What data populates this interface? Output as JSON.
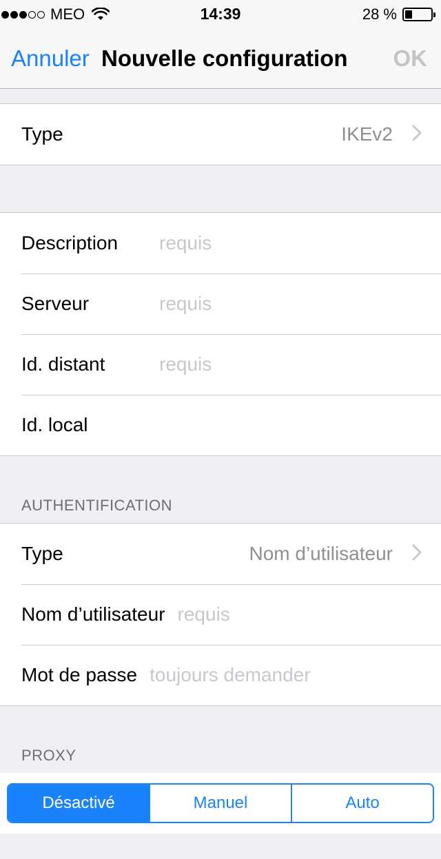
{
  "status_bar": {
    "carrier": "MEO",
    "time": "14:39",
    "battery_percent": "28 %",
    "battery_level": 0.28,
    "signal_bars_filled": 3,
    "signal_bars_total": 5
  },
  "nav": {
    "cancel_label": "Annuler",
    "title": "Nouvelle configuration",
    "ok_label": "OK"
  },
  "type_group": {
    "type_label": "Type",
    "type_value": "IKEv2"
  },
  "server_group": {
    "description_label": "Description",
    "description_placeholder": "requis",
    "server_label": "Serveur",
    "server_placeholder": "requis",
    "remote_id_label": "Id. distant",
    "remote_id_placeholder": "requis",
    "local_id_label": "Id. local",
    "local_id_value": ""
  },
  "auth": {
    "header": "AUTHENTIFICATION",
    "type_label": "Type",
    "type_value": "Nom d’utilisateur",
    "username_label": "Nom d’utilisateur",
    "username_placeholder": "requis",
    "password_label": "Mot de passe",
    "password_placeholder": "toujours demander"
  },
  "proxy": {
    "header": "PROXY",
    "options": [
      "Désactivé",
      "Manuel",
      "Auto"
    ],
    "selected": "Désactivé"
  },
  "colors": {
    "accent": "#1a82fb",
    "placeholder": "#c7c7cd",
    "disabled": "#c4c4c6",
    "background": "#efeff4"
  }
}
